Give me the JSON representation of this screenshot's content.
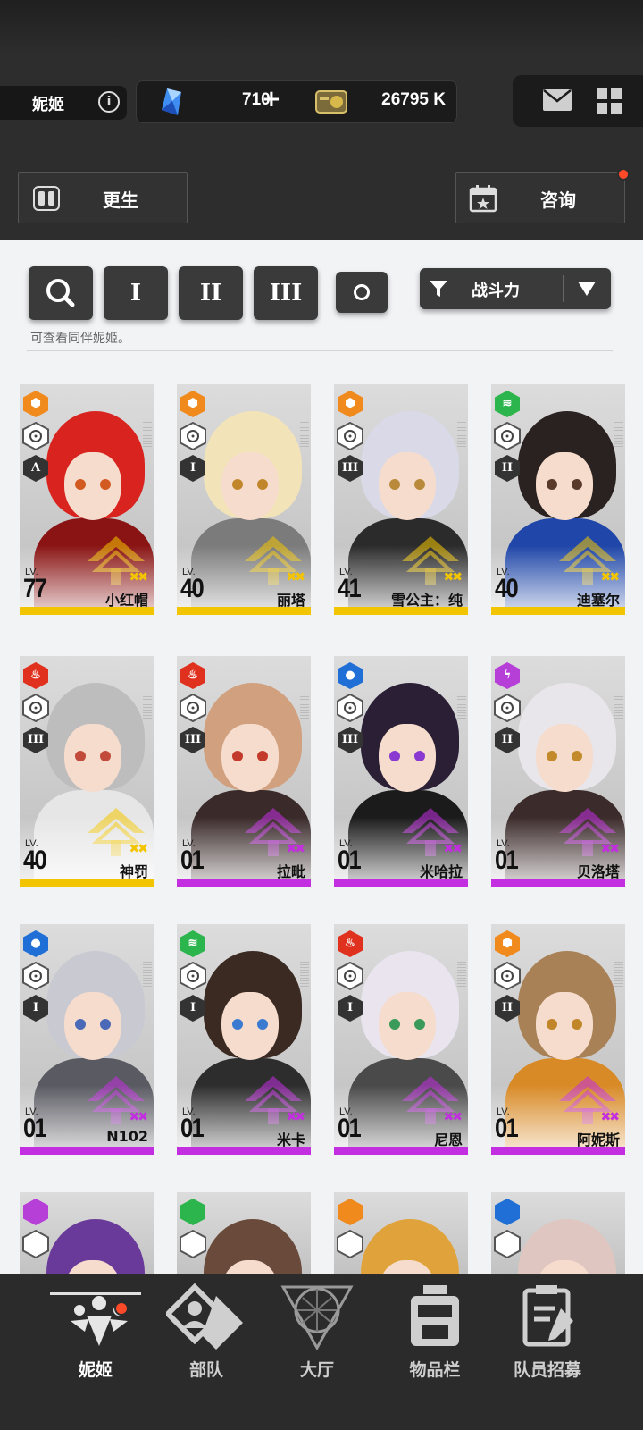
{
  "header": {
    "player_name": "妮姬",
    "gems": "710",
    "credits": "26795 K",
    "rebirth_label": "更生",
    "consult_label": "咨询"
  },
  "filters": {
    "tier1": "I",
    "tier2": "II",
    "tier3": "III",
    "sort_label": "战斗力",
    "hint": "可查看同伴妮姬。"
  },
  "cards": [
    {
      "name": "小红帽",
      "level": "77",
      "element": "core",
      "tier": "Λ",
      "rarity_color": "#f2c500"
    },
    {
      "name": "丽塔",
      "level": "40",
      "element": "core",
      "tier": "I",
      "rarity_color": "#f2c500"
    },
    {
      "name": "雪公主：纯",
      "level": "41",
      "element": "core",
      "tier": "III",
      "rarity_color": "#f2c500"
    },
    {
      "name": "迪塞尔",
      "level": "40",
      "element": "wind",
      "tier": "II",
      "rarity_color": "#f2c500"
    },
    {
      "name": "神罚",
      "level": "40",
      "element": "fire",
      "tier": "III",
      "rarity_color": "#f2c500"
    },
    {
      "name": "拉毗",
      "level": "01",
      "element": "fire",
      "tier": "III",
      "rarity_color": "#c22ee0"
    },
    {
      "name": "米哈拉",
      "level": "01",
      "element": "water",
      "tier": "III",
      "rarity_color": "#c22ee0"
    },
    {
      "name": "贝洛塔",
      "level": "01",
      "element": "electric",
      "tier": "II",
      "rarity_color": "#c22ee0"
    },
    {
      "name": "N102",
      "level": "01",
      "element": "water",
      "tier": "I",
      "rarity_color": "#c22ee0"
    },
    {
      "name": "米卡",
      "level": "01",
      "element": "wind",
      "tier": "I",
      "rarity_color": "#c22ee0"
    },
    {
      "name": "尼恩",
      "level": "01",
      "element": "fire",
      "tier": "I",
      "rarity_color": "#c22ee0"
    },
    {
      "name": "阿妮斯",
      "level": "01",
      "element": "core",
      "tier": "II",
      "rarity_color": "#c22ee0"
    }
  ],
  "nav": {
    "nikke": "妮姬",
    "squad": "部队",
    "lobby": "大厅",
    "inventory": "物品栏",
    "recruit": "队员招募"
  },
  "lv_prefix": "LV.",
  "colors": {
    "core": "#f08a1c",
    "wind": "#2bb54c",
    "fire": "#e0301e",
    "water": "#1f6fd6",
    "electric": "#b63fd8",
    "ssr_bar": "#f2c500",
    "sr_bar": "#c22ee0"
  }
}
